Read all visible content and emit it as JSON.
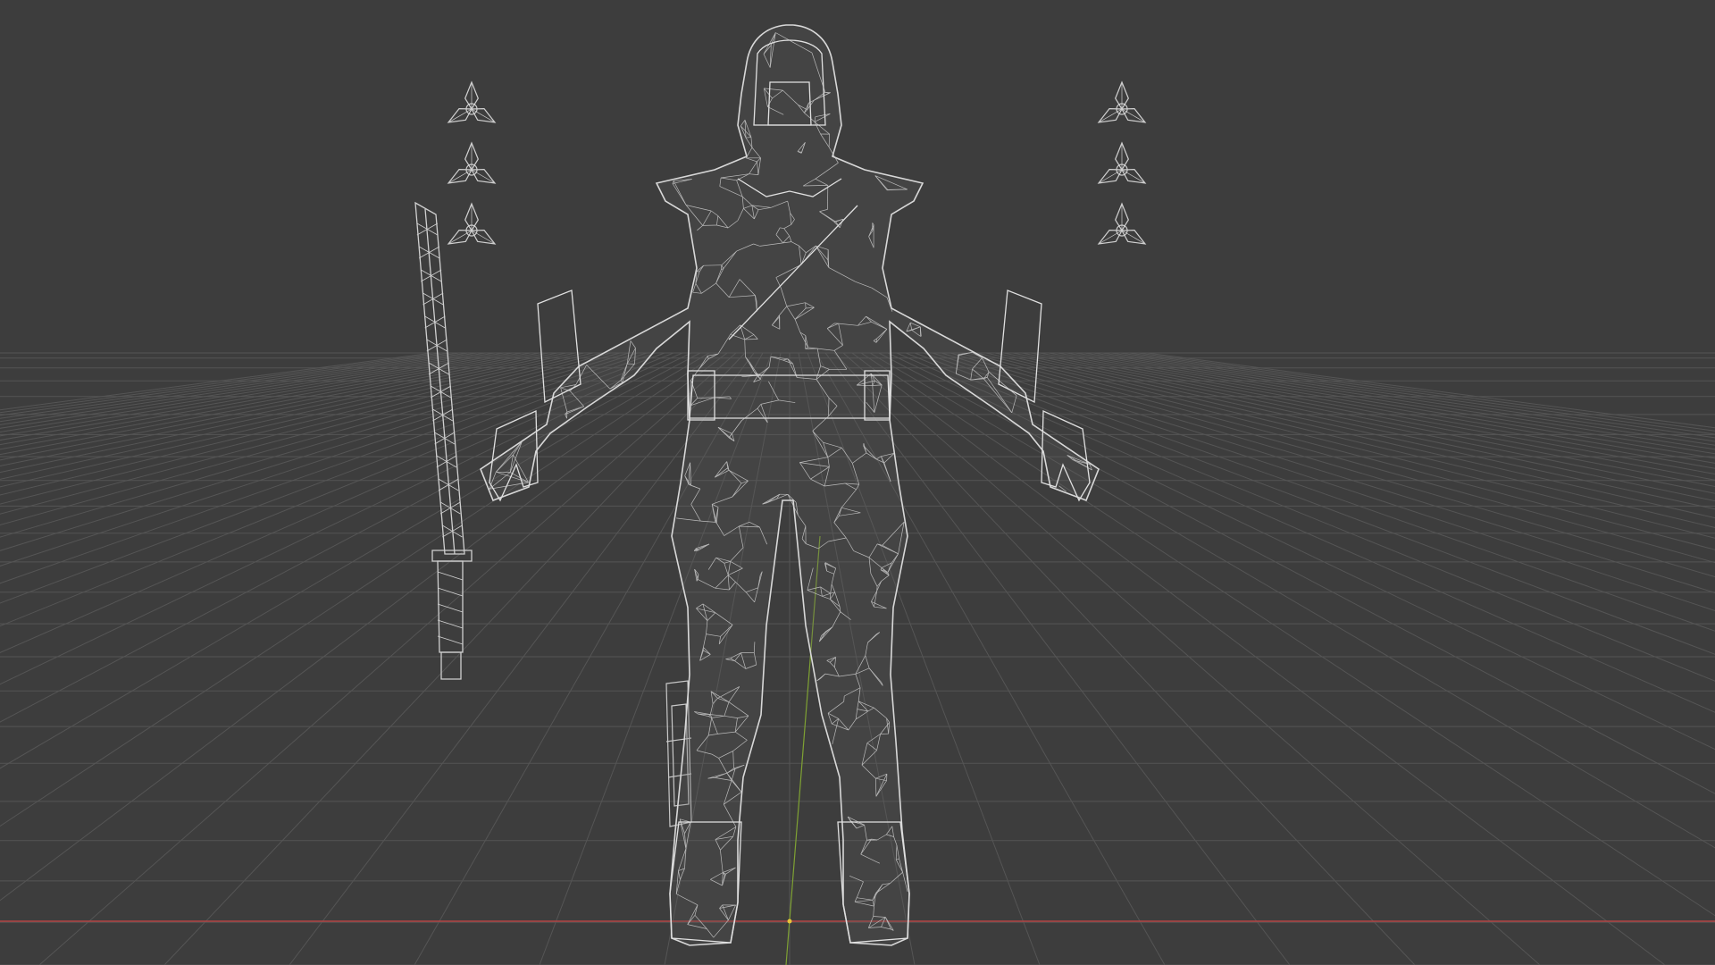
{
  "viewport": {
    "mode": "wireframe",
    "view": "front-perspective",
    "background_color": "#3d3d3d",
    "grid_color": "#555555",
    "wire_color": "#d0d0d0",
    "x_axis_color": "#b34545",
    "y_axis_color": "#7fa233",
    "origin_color": "#e8c23a"
  },
  "objects": [
    {
      "name": "ninja-character",
      "icon": "mesh-icon"
    },
    {
      "name": "katana",
      "icon": "mesh-icon"
    },
    {
      "name": "shuriken-left-1",
      "icon": "mesh-icon"
    },
    {
      "name": "shuriken-left-2",
      "icon": "mesh-icon"
    },
    {
      "name": "shuriken-left-3",
      "icon": "mesh-icon"
    },
    {
      "name": "shuriken-right-1",
      "icon": "mesh-icon"
    },
    {
      "name": "shuriken-right-2",
      "icon": "mesh-icon"
    },
    {
      "name": "shuriken-right-3",
      "icon": "mesh-icon"
    },
    {
      "name": "leg-holster",
      "icon": "mesh-icon"
    }
  ]
}
